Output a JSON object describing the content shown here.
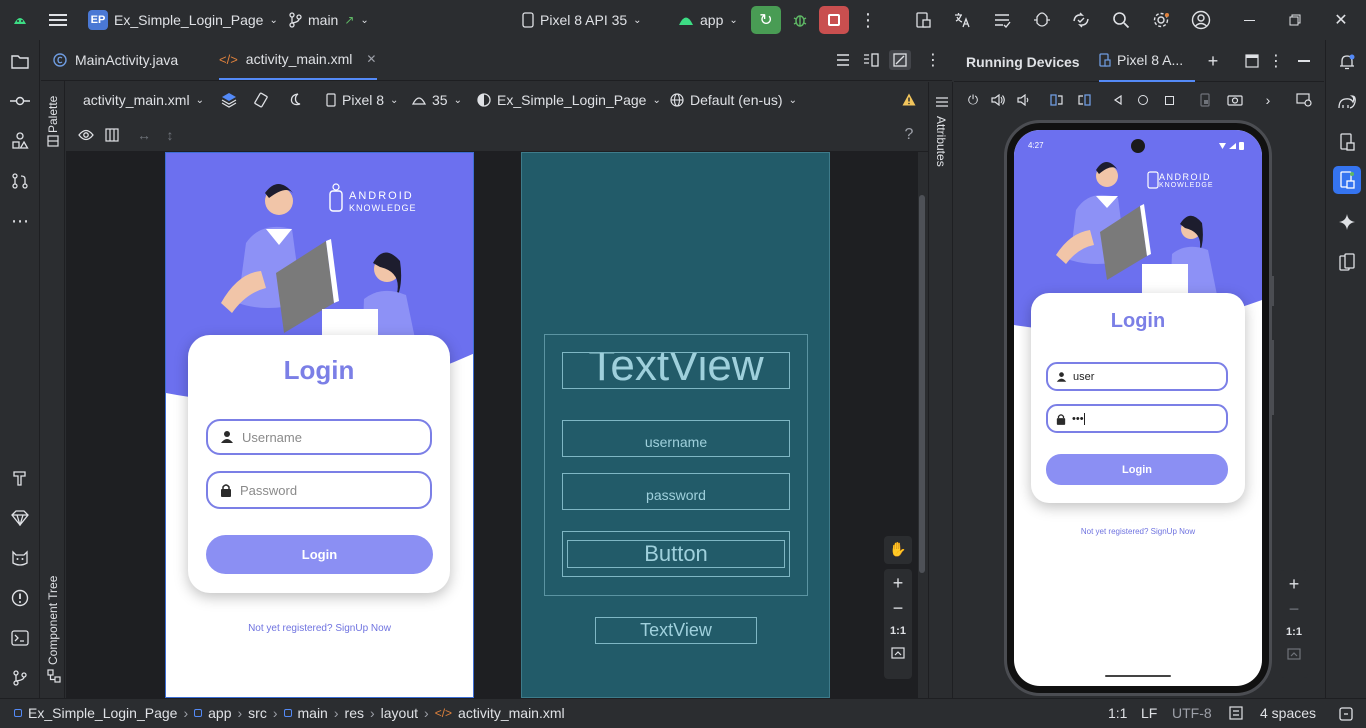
{
  "titlebar": {
    "project_badge": "EP",
    "project_name": "Ex_Simple_Login_Page",
    "branch": "main",
    "device": "Pixel 8 API 35",
    "run_config": "app"
  },
  "editor_tabs": [
    {
      "label": "MainActivity.java"
    },
    {
      "label": "activity_main.xml"
    }
  ],
  "palette_label": "Palette",
  "component_tree_label": "Component Tree",
  "attributes_label": "Attributes",
  "design_toolbar": {
    "file": "activity_main.xml",
    "device": "Pixel 8",
    "api": "35",
    "theme": "Ex_Simple_Login_Page",
    "locale": "Default (en-us)"
  },
  "preview": {
    "logo_line1": "ANDROID",
    "logo_line2": "KNOWLEDGE",
    "title": "Login",
    "username_placeholder": "Username",
    "password_placeholder": "Password",
    "login_button": "Login",
    "signup_text": "Not yet registered? SignUp Now"
  },
  "blueprint": {
    "title": "TextView",
    "username": "username",
    "password": "password",
    "button": "Button",
    "footer": "TextView"
  },
  "zoom": {
    "ratio": "1:1"
  },
  "running_devices": {
    "title": "Running Devices",
    "device_tab": "Pixel 8 A..."
  },
  "device_screen": {
    "time": "4:27",
    "logo_line1": "ANDROID",
    "logo_line2": "KNOWLEDGE",
    "title": "Login",
    "username_value": "user",
    "password_value": "•••",
    "login_button": "Login",
    "signup_text": "Not yet registered? SignUp Now"
  },
  "statusbar": {
    "breadcrumbs": [
      "Ex_Simple_Login_Page",
      "app",
      "src",
      "main",
      "res",
      "layout",
      "activity_main.xml"
    ],
    "position": "1:1",
    "line_sep": "LF",
    "encoding": "UTF-8",
    "indent": "4 spaces"
  },
  "colors": {
    "accent_purple": "#7b7fe6",
    "button_purple": "#8b8ff3",
    "blueprint_bg": "#225b69",
    "run_green": "#499c54",
    "stop_red": "#c94f4f"
  }
}
